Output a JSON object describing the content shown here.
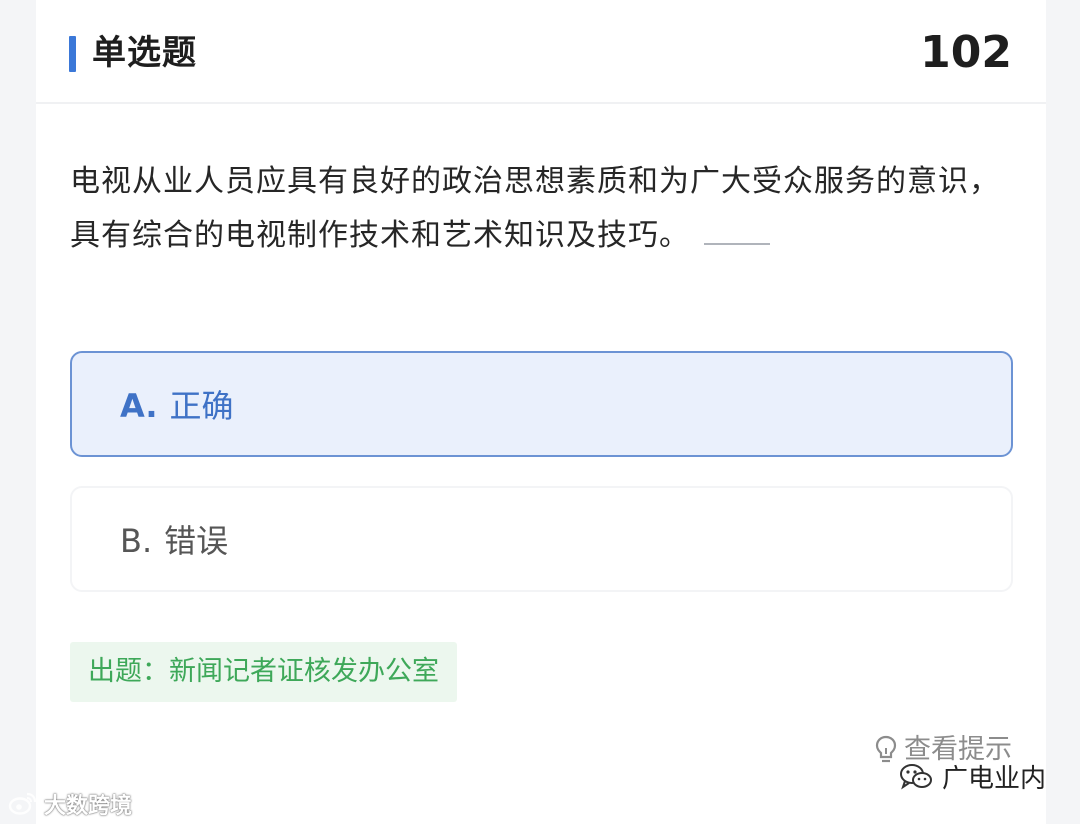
{
  "header": {
    "title": "单选题",
    "number": "102",
    "accent_color": "#3b78d8"
  },
  "question": {
    "text": "电视从业人员应具有良好的政治思想素质和为广大受众服务的意识，具有综合的电视制作技术和艺术知识及技巧。"
  },
  "options": [
    {
      "letter": "A.",
      "label": "正确",
      "selected": true
    },
    {
      "letter": "B.",
      "label": "错误",
      "selected": false
    }
  ],
  "source": {
    "text": "出题：新闻记者证核发办公室",
    "color": "#3ea859"
  },
  "hint": {
    "label": "查看提示",
    "icon": "lightbulb-icon"
  },
  "watermarks": {
    "left": {
      "text": "大数跨境",
      "icon": "weibo-logo-icon"
    },
    "right": {
      "text": "广电业内",
      "icon": "wechat-logo-icon"
    }
  }
}
